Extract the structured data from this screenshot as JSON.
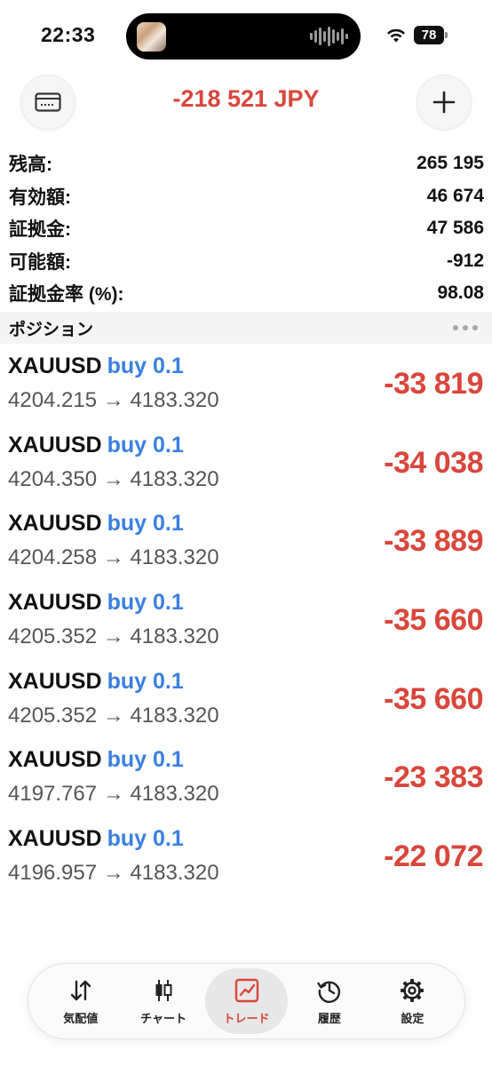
{
  "status_bar": {
    "time": "22:33",
    "battery": "78"
  },
  "header": {
    "title": "-218 521 JPY",
    "left_icon": "card-icon",
    "right_icon": "plus-icon"
  },
  "summary": [
    {
      "label": "残高:",
      "value": "265 195"
    },
    {
      "label": "有効額:",
      "value": "46 674"
    },
    {
      "label": "証拠金:",
      "value": "47 586"
    },
    {
      "label": "可能額:",
      "value": "-912"
    },
    {
      "label": "証拠金率 (%):",
      "value": "98.08"
    }
  ],
  "section": {
    "title": "ポジション"
  },
  "positions": [
    {
      "symbol": "XAUUSD",
      "type": "buy 0.1",
      "prices": "4204.215 → 4183.320",
      "profit": "-33 819"
    },
    {
      "symbol": "XAUUSD",
      "type": "buy 0.1",
      "prices": "4204.350 → 4183.320",
      "profit": "-34 038"
    },
    {
      "symbol": "XAUUSD",
      "type": "buy 0.1",
      "prices": "4204.258 → 4183.320",
      "profit": "-33 889"
    },
    {
      "symbol": "XAUUSD",
      "type": "buy 0.1",
      "prices": "4205.352 → 4183.320",
      "profit": "-35 660"
    },
    {
      "symbol": "XAUUSD",
      "type": "buy 0.1",
      "prices": "4205.352 → 4183.320",
      "profit": "-35 660"
    },
    {
      "symbol": "XAUUSD",
      "type": "buy 0.1",
      "prices": "4197.767 → 4183.320",
      "profit": "-23 383"
    },
    {
      "symbol": "XAUUSD",
      "type": "buy 0.1",
      "prices": "4196.957 → 4183.320",
      "profit": "-22 072"
    }
  ],
  "tabs": [
    {
      "label": "気配値",
      "icon": "quotes-arrows-icon"
    },
    {
      "label": "チャート",
      "icon": "candlestick-icon"
    },
    {
      "label": "トレード",
      "icon": "trade-chart-icon",
      "active": true
    },
    {
      "label": "履歴",
      "icon": "history-clock-icon"
    },
    {
      "label": "設定",
      "icon": "gear-icon"
    }
  ],
  "colors": {
    "loss": "#d9463b",
    "buy": "#3b7fe0"
  }
}
